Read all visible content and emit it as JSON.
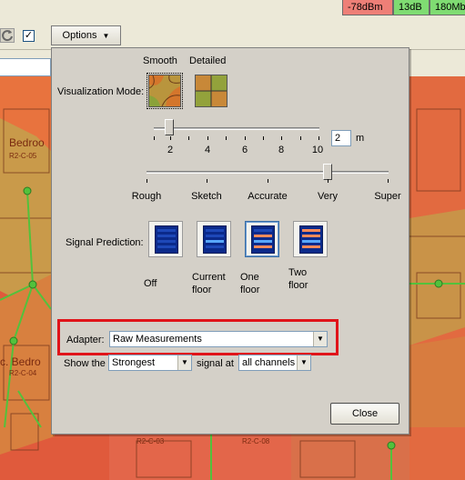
{
  "toolbar": {
    "options_label": "Options",
    "legend": [
      {
        "text": "-78dBm",
        "color": "#ee7f77"
      },
      {
        "text": "13dB",
        "color": "#7fdc72"
      },
      {
        "text": "180Mb",
        "color": "#7fdc72"
      }
    ],
    "checkbox_checked": true
  },
  "map": {
    "labels": [
      "Bedroo",
      "R2-C-05",
      "c. Bedro",
      "R2-C-04",
      "R2-C-03",
      "R2-C-08"
    ]
  },
  "panel": {
    "viz_mode_label": "Visualization Mode:",
    "viz_options": [
      {
        "label": "Smooth",
        "selected": true
      },
      {
        "label": "Detailed",
        "selected": false
      }
    ],
    "size_slider": {
      "ticks": [
        "2",
        "4",
        "6",
        "8",
        "10"
      ],
      "value": "2",
      "unit": "m"
    },
    "quality_slider": {
      "ticks": [
        "Rough",
        "Sketch",
        "Accurate",
        "Very",
        "Super"
      ],
      "selected": "Very"
    },
    "signal_prediction_label": "Signal Prediction:",
    "prediction_options": [
      {
        "label_lines": [
          "Off"
        ],
        "selected": false
      },
      {
        "label_lines": [
          "Current",
          "floor"
        ],
        "selected": false
      },
      {
        "label_lines": [
          "One",
          "floor"
        ],
        "selected": true
      },
      {
        "label_lines": [
          "Two",
          "floor"
        ],
        "selected": false
      }
    ],
    "adapter_label": "Adapter:",
    "adapter_value": "Raw Measurements",
    "show_the_label": "Show the",
    "strength_value": "Strongest",
    "signal_at_label": "signal at",
    "channels_value": "all channels",
    "close_label": "Close"
  }
}
